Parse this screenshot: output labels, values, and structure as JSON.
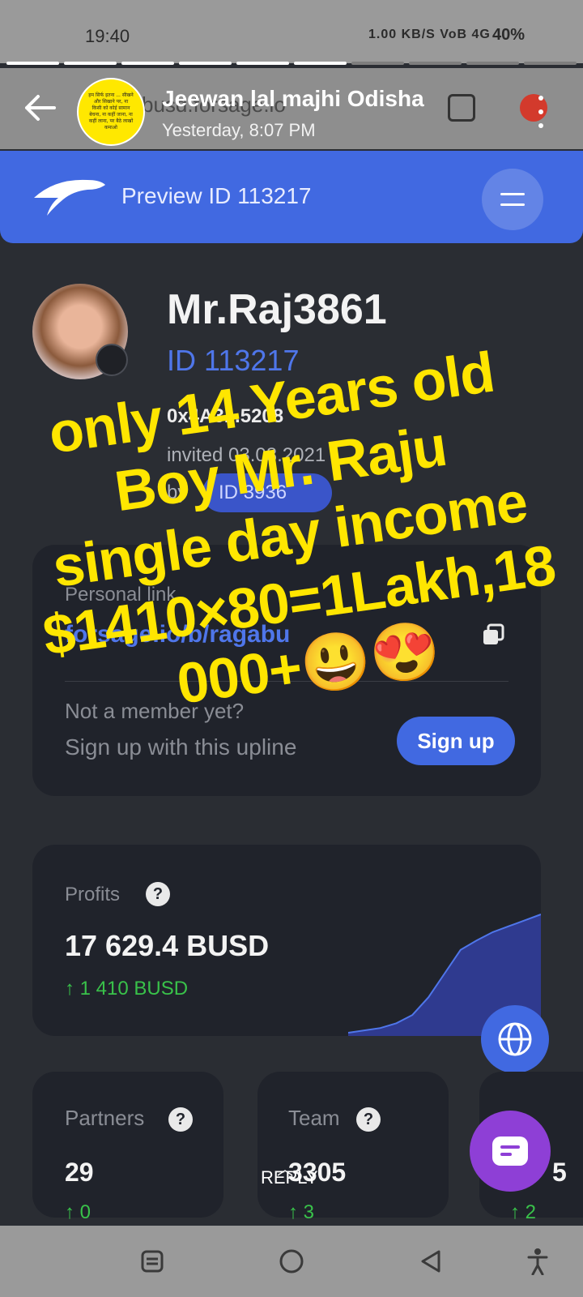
{
  "status_bar": {
    "time": "19:40",
    "network": "1.00 KB/S  VoB  4G",
    "battery": "40%"
  },
  "story": {
    "user_name": "Jeewan lal majhi Odisha",
    "timestamp": "Yesterday, 8:07 PM",
    "avatar_text": "हम सिर्फ इतना ... सीखने और सिखाने पर, ना किसी को कोई सामान बेचना, ना कहीं जाना, ना कहीं लाना, पर बैठे लाखों कमाओ",
    "progress_total": 10,
    "progress_done": 6,
    "behind_url": "busd.forsage.io"
  },
  "app": {
    "header_title": "Preview ID 113217",
    "profile": {
      "name": "Mr.Raj3861",
      "id": "ID 113217",
      "wallet": "0x4A3...5208",
      "invited": "invited 03.08.2021",
      "by": "by",
      "by_id": "ID 3936"
    },
    "referral": {
      "label": "Personal link",
      "link": "forsage.io/b/ragabu",
      "not_member": "Not a member yet?",
      "signup_hint": "Sign up with this upline",
      "signup_button": "Sign up"
    },
    "profits": {
      "label": "Profits",
      "value": "17 629.4 BUSD",
      "delta": "↑ 1 410 BUSD"
    },
    "partners": {
      "label": "Partners",
      "value": "29",
      "delta": "↑ 0"
    },
    "team": {
      "label": "Team",
      "value": "3305",
      "delta": "↑ 3"
    },
    "third": {
      "value": "5",
      "delta": "↑ 2"
    }
  },
  "overlay_text": [
    "only 14 Years old",
    "Boy Mr. Raju",
    "single day income",
    "$1410×80=1Lakh,18",
    "000+😃😍"
  ],
  "reply_label": "REPLY",
  "chart_data": {
    "type": "area",
    "x": [
      0,
      1,
      2,
      3,
      4,
      5,
      6,
      7,
      8,
      9,
      10,
      11,
      12
    ],
    "values": [
      0,
      0.02,
      0.04,
      0.08,
      0.15,
      0.3,
      0.5,
      0.7,
      0.78,
      0.85,
      0.9,
      0.95,
      1.0
    ],
    "color": "#2f3a8f"
  },
  "colors": {
    "accent": "#4169e1",
    "overlay": "#ffe600",
    "positive": "#39c24a"
  }
}
